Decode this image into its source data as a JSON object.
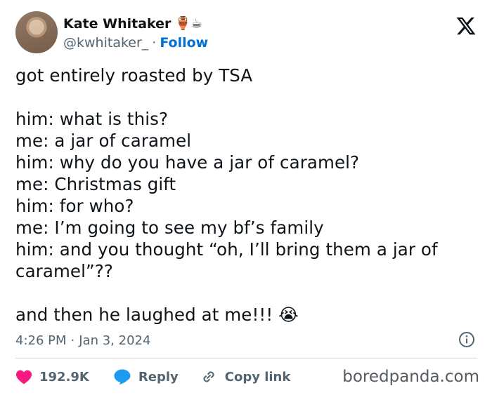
{
  "author": {
    "display_name": "Kate Whitaker",
    "emojis": "🏺☕",
    "handle": "@kwhitaker_",
    "separator": "·",
    "follow_label": "Follow"
  },
  "tweet": {
    "lines": [
      "got entirely roasted by TSA",
      "",
      "him: what is this?",
      "me: a jar of caramel",
      "him: why do you have a jar of caramel?",
      "me: Christmas gift",
      "him: for who?",
      "me: I’m going to see my bf’s family",
      "him: and you thought “oh, I’ll bring them a jar of",
      "caramel”??",
      "",
      "and then he laughed at me!!! 😭"
    ],
    "time": "4:26 PM",
    "separator": "·",
    "date": "Jan 3, 2024"
  },
  "actions": {
    "likes_count": "192.9K",
    "reply_label": "Reply",
    "copy_link_label": "Copy link"
  },
  "watermark": "boredpanda.com",
  "colors": {
    "heart": "#f91880",
    "reply_bubble": "#1d9bf0",
    "link_blue": "#006fd6",
    "muted": "#536471"
  }
}
